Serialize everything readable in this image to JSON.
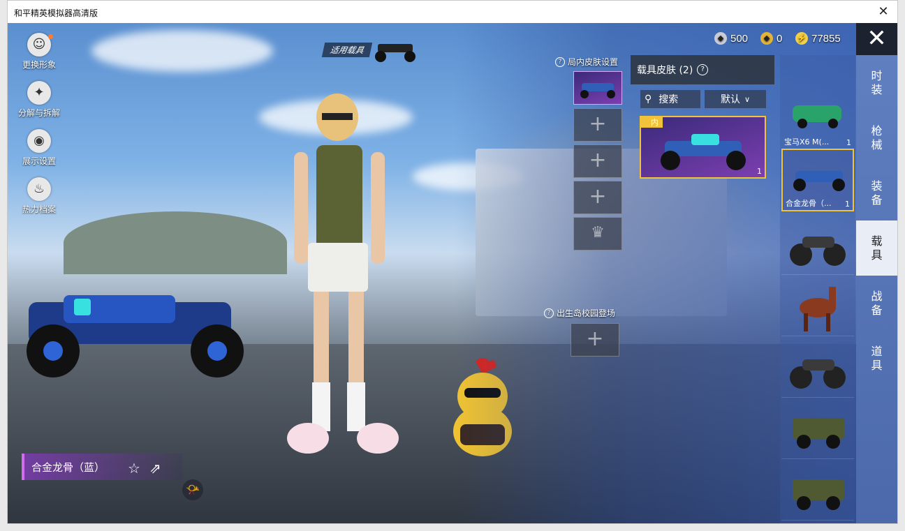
{
  "window": {
    "title": "和平精英模拟器高清版",
    "close_label": "✕"
  },
  "left_menu": [
    {
      "label": "更换形象",
      "icon": "avatar-icon"
    },
    {
      "label": "分解与拆解",
      "icon": "puzzle-icon"
    },
    {
      "label": "展示设置",
      "icon": "eye-icon"
    },
    {
      "label": "热力档案",
      "icon": "flame-icon"
    }
  ],
  "vehicle_tag": "适用载具",
  "currencies": [
    {
      "value": "500",
      "icon": "coin-silver-icon"
    },
    {
      "value": "0",
      "icon": "coin-gold-icon"
    },
    {
      "value": "77855",
      "icon": "coupon-icon"
    }
  ],
  "close_button": "✕",
  "tabs": [
    "时装",
    "枪械",
    "装备",
    "载具",
    "战备",
    "道具"
  ],
  "active_tab": "载具",
  "items": [
    {
      "name": "宝马X6 M(...",
      "count": "1",
      "color": "#2aa36b"
    },
    {
      "name": "合金龙骨（...",
      "count": "1",
      "color": "#2f5fb6"
    },
    {
      "name": "",
      "count": "",
      "color": "#333333"
    },
    {
      "name": "",
      "count": "",
      "color": "#8a3a1f"
    },
    {
      "name": "",
      "count": "",
      "color": "#333333"
    },
    {
      "name": "",
      "count": "",
      "color": "#4f5a32"
    },
    {
      "name": "",
      "count": "",
      "color": "#4f5a32"
    }
  ],
  "skins_panel": {
    "title": "载具皮肤 (2)",
    "search_label": "搜索",
    "sort_label": "默认",
    "card_badge": "内",
    "card_count": "1"
  },
  "in_game_skin_label": "局内皮肤设置",
  "slot_plus": "+",
  "entrance_label": "出生岛校园登场",
  "selected_name": "合金龙骨（蓝）",
  "accent": "#f0c33a"
}
